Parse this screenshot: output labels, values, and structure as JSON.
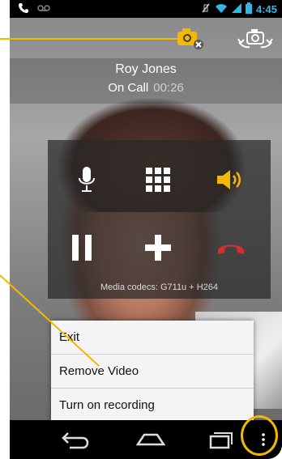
{
  "status_bar": {
    "time": "4:45",
    "icons": [
      "phone-icon",
      "voicemail-icon",
      "no-vibrate-icon",
      "wifi-icon",
      "signal-icon",
      "battery-icon"
    ]
  },
  "call": {
    "caller_name": "Roy Jones",
    "state": "On Call",
    "timer": "00:26",
    "codecs": "Media codecs: G711u + H264"
  },
  "controls": [
    {
      "name": "microphone-button",
      "icon": "microphone-icon"
    },
    {
      "name": "keypad-button",
      "icon": "keypad-icon"
    },
    {
      "name": "speaker-button",
      "icon": "speaker-icon"
    },
    {
      "name": "hold-button",
      "icon": "pause-icon"
    },
    {
      "name": "add-call-button",
      "icon": "plus-icon"
    },
    {
      "name": "end-call-button",
      "icon": "hangup-icon"
    }
  ],
  "menu": {
    "items": [
      "Exit",
      "Remove Video",
      "Turn on recording"
    ]
  },
  "nav": {
    "icons": [
      "back-icon",
      "home-icon",
      "recents-icon",
      "overflow-menu-icon"
    ]
  },
  "colors": {
    "accent_yellow": "#f5b800",
    "status_blue": "#33b5e5",
    "hangup_red": "#d32f2f",
    "speaker_yellow": "#f5b800"
  }
}
